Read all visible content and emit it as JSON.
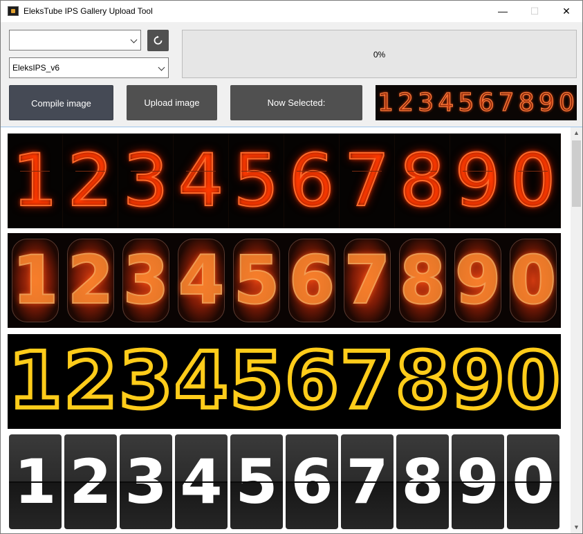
{
  "window": {
    "title": "EleksTube IPS Gallery Upload Tool"
  },
  "titlebar": {
    "minimize": "—",
    "maximize": "☐",
    "close": "✕"
  },
  "controls": {
    "port_value": "",
    "model_value": "EleksIPS_v6",
    "progress": {
      "value": 0,
      "label": "0%"
    },
    "compile_label": "Compile image",
    "upload_label": "Upload image",
    "selected_label": "Now Selected:"
  },
  "preview_digits": [
    "1",
    "2",
    "3",
    "4",
    "5",
    "6",
    "7",
    "8",
    "9",
    "0"
  ],
  "gallery": {
    "styles": [
      {
        "digits": [
          "1",
          "2",
          "3",
          "4",
          "5",
          "6",
          "7",
          "8",
          "9",
          "0"
        ]
      },
      {
        "digits": [
          "1",
          "2",
          "3",
          "4",
          "5",
          "6",
          "7",
          "8",
          "9",
          "0"
        ]
      },
      {
        "digits": [
          "1",
          "2",
          "3",
          "4",
          "5",
          "6",
          "7",
          "8",
          "9",
          "0"
        ]
      },
      {
        "digits": [
          "1",
          "2",
          "3",
          "4",
          "5",
          "6",
          "7",
          "8",
          "9",
          "0"
        ]
      }
    ]
  },
  "scrollbar": {
    "up": "▲",
    "down": "▼"
  },
  "colors": {
    "accent_button": "#454a55",
    "button": "#505050",
    "nixie_glow": "#ff6a2a",
    "dot_matrix": "#ffcc1a"
  }
}
